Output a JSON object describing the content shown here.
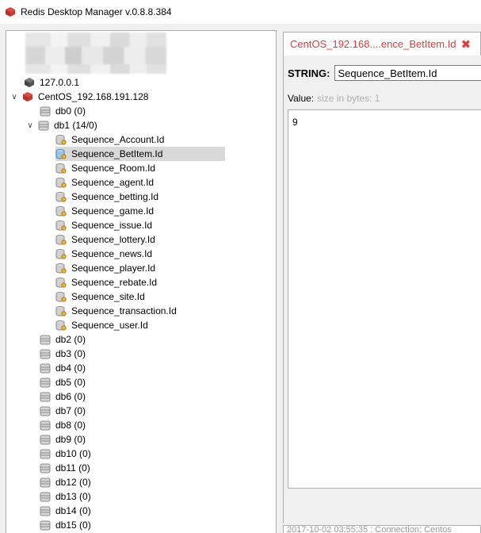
{
  "window": {
    "title": "Redis Desktop Manager v.0.8.8.384"
  },
  "tree": {
    "localhost": {
      "label": "127.0.0.1"
    },
    "server": {
      "label": "CentOS_192.168.191.128"
    },
    "db0": {
      "label": "db0  (0)"
    },
    "db1": {
      "label": "db1  (14/0)",
      "keys": [
        "Sequence_Account.Id",
        "Sequence_BetItem.Id",
        "Sequence_Room.Id",
        "Sequence_agent.Id",
        "Sequence_betting.Id",
        "Sequence_game.Id",
        "Sequence_issue.Id",
        "Sequence_lottery.Id",
        "Sequence_news.Id",
        "Sequence_player.Id",
        "Sequence_rebate.Id",
        "Sequence_site.Id",
        "Sequence_transaction.Id",
        "Sequence_user.Id"
      ]
    },
    "dbs": [
      "db2 (0)",
      "db3 (0)",
      "db4 (0)",
      "db5 (0)",
      "db6 (0)",
      "db7 (0)",
      "db8 (0)",
      "db9 (0)",
      "db10 (0)",
      "db11 (0)",
      "db12 (0)",
      "db13 (0)",
      "db14 (0)",
      "db15 (0)"
    ]
  },
  "editor": {
    "tab_label": "CentOS_192.168....ence_BetItem.Id",
    "type_label": "STRING:",
    "key_value": "Sequence_BetItem.Id",
    "value_label": "Value:",
    "value_hint": "size in bytes: 1",
    "value_text": "9",
    "log_text": "2017-10-02 03:55:35 : Connection: Centos"
  },
  "colors": {
    "accent": "#e03a3a",
    "selection": "#d9d9d9"
  }
}
